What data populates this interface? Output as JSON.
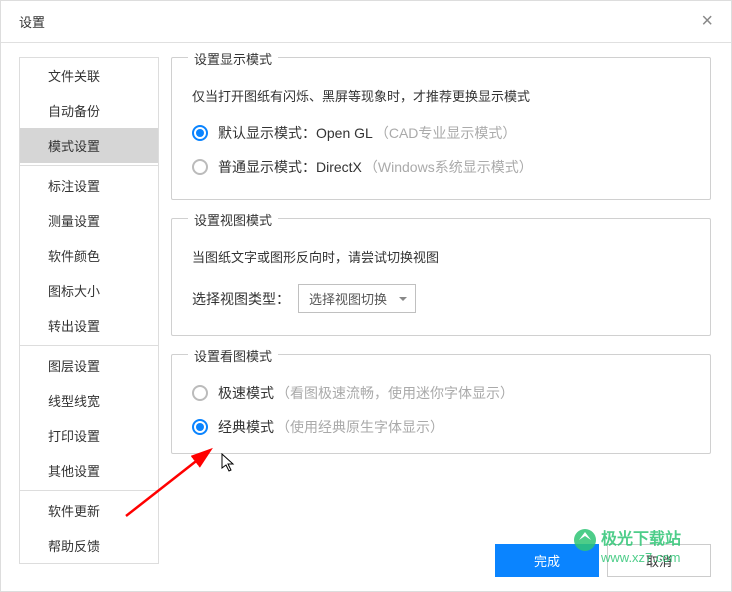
{
  "dialog": {
    "title": "设置"
  },
  "sidebar": {
    "items": [
      {
        "label": "文件关联"
      },
      {
        "label": "自动备份"
      },
      {
        "label": "模式设置",
        "active": true
      },
      {
        "label": "标注设置"
      },
      {
        "label": "测量设置"
      },
      {
        "label": "软件颜色"
      },
      {
        "label": "图标大小"
      },
      {
        "label": "转出设置"
      },
      {
        "label": "图层设置"
      },
      {
        "label": "线型线宽"
      },
      {
        "label": "打印设置"
      },
      {
        "label": "其他设置"
      },
      {
        "label": "软件更新"
      },
      {
        "label": "帮助反馈"
      }
    ]
  },
  "groups": {
    "display": {
      "title": "设置显示模式",
      "desc": "仅当打开图纸有闪烁、黑屏等现象时，才推荐更换显示模式",
      "opt1": {
        "label": "默认显示模式：Open GL",
        "hint": "（CAD专业显示模式）"
      },
      "opt2": {
        "label": "普通显示模式：DirectX",
        "hint": "（Windows系统显示模式）"
      }
    },
    "view": {
      "title": "设置视图模式",
      "desc": "当图纸文字或图形反向时，请尝试切换视图",
      "selectLabel": "选择视图类型：",
      "selectValue": "选择视图切换"
    },
    "viewer": {
      "title": "设置看图模式",
      "opt1": {
        "label": "极速模式",
        "hint": "（看图极速流畅，使用迷你字体显示）"
      },
      "opt2": {
        "label": "经典模式",
        "hint": "（使用经典原生字体显示）"
      }
    }
  },
  "footer": {
    "ok": "完成",
    "cancel": "取消"
  },
  "watermark": {
    "line1": "极光下载站",
    "line2": "www.xz7.com"
  }
}
